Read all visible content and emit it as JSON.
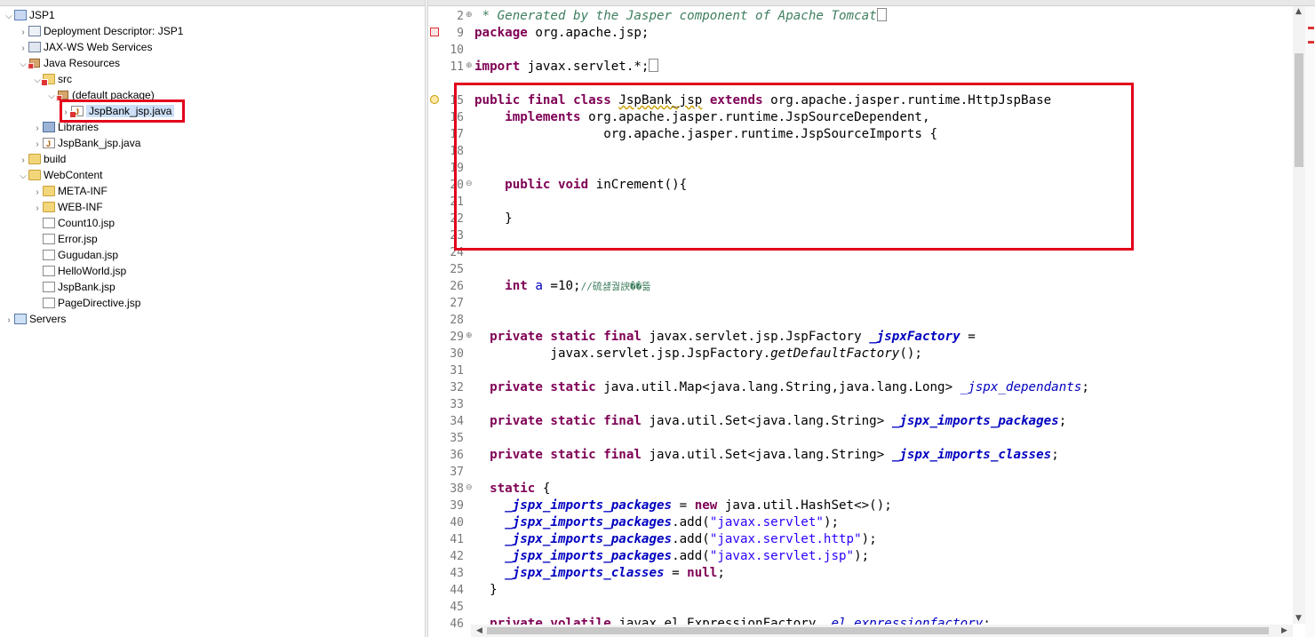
{
  "explorer": {
    "items": [
      {
        "label": "JSP1",
        "icon": "project-icon",
        "twisty": "expanded"
      },
      {
        "label": "Deployment Descriptor: JSP1",
        "icon": "deployment-descriptor-icon",
        "twisty": "collapsed"
      },
      {
        "label": "JAX-WS Web Services",
        "icon": "web-services-icon",
        "twisty": "collapsed"
      },
      {
        "label": "Java Resources",
        "icon": "java-resources-icon",
        "twisty": "expanded"
      },
      {
        "label": "src",
        "icon": "source-folder-icon",
        "twisty": "expanded"
      },
      {
        "label": "(default package)",
        "icon": "package-icon",
        "twisty": "expanded"
      },
      {
        "label": "JspBank_jsp.java",
        "icon": "java-file-icon",
        "twisty": "collapsed",
        "selected": true
      },
      {
        "label": "Libraries",
        "icon": "libraries-icon",
        "twisty": "collapsed"
      },
      {
        "label": "JspBank_jsp.java",
        "icon": "java-file-icon",
        "twisty": "collapsed"
      },
      {
        "label": "build",
        "icon": "folder-icon",
        "twisty": "collapsed"
      },
      {
        "label": "WebContent",
        "icon": "folder-icon",
        "twisty": "expanded"
      },
      {
        "label": "META-INF",
        "icon": "folder-icon",
        "twisty": "collapsed"
      },
      {
        "label": "WEB-INF",
        "icon": "folder-icon",
        "twisty": "collapsed"
      },
      {
        "label": "Count10.jsp",
        "icon": "jsp-file-icon",
        "twisty": "none"
      },
      {
        "label": "Error.jsp",
        "icon": "jsp-file-icon",
        "twisty": "none"
      },
      {
        "label": "Gugudan.jsp",
        "icon": "jsp-file-icon",
        "twisty": "none"
      },
      {
        "label": "HelloWorld.jsp",
        "icon": "jsp-file-icon",
        "twisty": "none"
      },
      {
        "label": "JspBank.jsp",
        "icon": "jsp-file-icon",
        "twisty": "none"
      },
      {
        "label": "PageDirective.jsp",
        "icon": "jsp-file-icon",
        "twisty": "none"
      },
      {
        "label": "Servers",
        "icon": "servers-folder-icon",
        "twisty": "collapsed"
      }
    ]
  },
  "editor": {
    "line_numbers": [
      "2",
      "9",
      "10",
      "11",
      "",
      "15",
      "16",
      "17",
      "18",
      "19",
      "20",
      "21",
      "22",
      "23",
      "24",
      "25",
      "26",
      "27",
      "28",
      "29",
      "30",
      "31",
      "32",
      "33",
      "34",
      "35",
      "36",
      "37",
      "38",
      "39",
      "40",
      "41",
      "42",
      "43",
      "44",
      "45",
      "46"
    ],
    "folded_lines": [
      "2",
      "11",
      "20",
      "29",
      "38"
    ],
    "code": {
      "l2": " * Generated by the Jasper component of Apache Tomcat",
      "l9a": "package",
      "l9b": " org.apache.jsp;",
      "l11a": "import",
      "l11b": " javax.servlet.*;",
      "l15a": "public",
      "l15b": "final",
      "l15c": "class",
      "l15d": "JspBank_jsp",
      "l15e": "extends",
      "l15f": " org.apache.jasper.runtime.HttpJspBase",
      "l16a": "    implements",
      "l16b": " org.apache.jasper.runtime.JspSourceDependent,",
      "l17": "                 org.apache.jasper.runtime.JspSourceImports {",
      "l20a": "    public",
      "l20b": "void",
      "l20c": " inCrement(){",
      "l22": "    }",
      "l26a": "    int",
      "l26b": "a",
      "l26c": " =10;",
      "l26d": "//硫섏궗諛��뜲",
      "l29a": "  private",
      "l29b": "static",
      "l29c": "final",
      "l29d": " javax.servlet.jsp.JspFactory ",
      "l29e": "_jspxFactory",
      "l29f": " =",
      "l30a": "          javax.servlet.jsp.JspFactory.",
      "l30b": "getDefaultFactory",
      "l30c": "();",
      "l32a": "  private",
      "l32b": "static",
      "l32c": " java.util.Map<java.lang.String,java.lang.Long> ",
      "l32d": "_jspx_dependants",
      "l32e": ";",
      "l34a": "  private",
      "l34b": "static",
      "l34c": "final",
      "l34d": " java.util.Set<java.lang.String> ",
      "l34e": "_jspx_imports_packages",
      "l34f": ";",
      "l36a": "  private",
      "l36b": "static",
      "l36c": "final",
      "l36d": " java.util.Set<java.lang.String> ",
      "l36e": "_jspx_imports_classes",
      "l36f": ";",
      "l38a": "  static",
      "l38b": " {",
      "l39a": "    _jspx_imports_packages",
      "l39b": " = ",
      "l39c": "new",
      "l39d": " java.util.HashSet<>();",
      "l40a": "    _jspx_imports_packages",
      "l40b": ".add(",
      "l40c": "\"javax.servlet\"",
      "l40d": ");",
      "l41a": "    _jspx_imports_packages",
      "l41b": ".add(",
      "l41c": "\"javax.servlet.http\"",
      "l41d": ");",
      "l42a": "    _jspx_imports_packages",
      "l42b": ".add(",
      "l42c": "\"javax.servlet.jsp\"",
      "l42d": ");",
      "l43a": "    _jspx_imports_classes",
      "l43b": " = ",
      "l43c": "null",
      "l43d": ";",
      "l44": "  }",
      "l46a": "  private",
      "l46b": "volatile",
      "l46c": " javax.el.ExpressionFactory ",
      "l46d": "_el_expressionfactory",
      "l46e": ";"
    }
  },
  "colors": {
    "highlight_box": "#e3001b",
    "keyword": "#7f0055",
    "comment": "#3f7f5f",
    "string": "#2a00ff",
    "field": "#0000c0"
  }
}
